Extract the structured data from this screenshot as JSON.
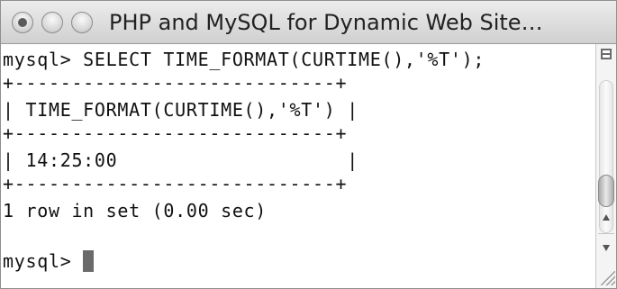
{
  "window": {
    "title": "PHP and MySQL for Dynamic Web Site…"
  },
  "terminal": {
    "lines": [
      "mysql> SELECT TIME_FORMAT(CURTIME(),'%T');",
      "+----------------------------+",
      "| TIME_FORMAT(CURTIME(),'%T') |",
      "+----------------------------+",
      "| 14:25:00                    |",
      "+----------------------------+",
      "1 row in set (0.00 sec)",
      "",
      "mysql> "
    ]
  },
  "icons": {
    "close": "close-button-icon",
    "minimize": "minimize-button-icon",
    "zoom": "zoom-button-icon",
    "split": "split-pane-icon",
    "up": "arrow-up-icon",
    "down": "arrow-down-icon",
    "resize": "resize-grip-icon"
  },
  "colors": {
    "titlebar": "#d6d6d6",
    "text": "#111111",
    "cursor": "#6a6a6a"
  }
}
